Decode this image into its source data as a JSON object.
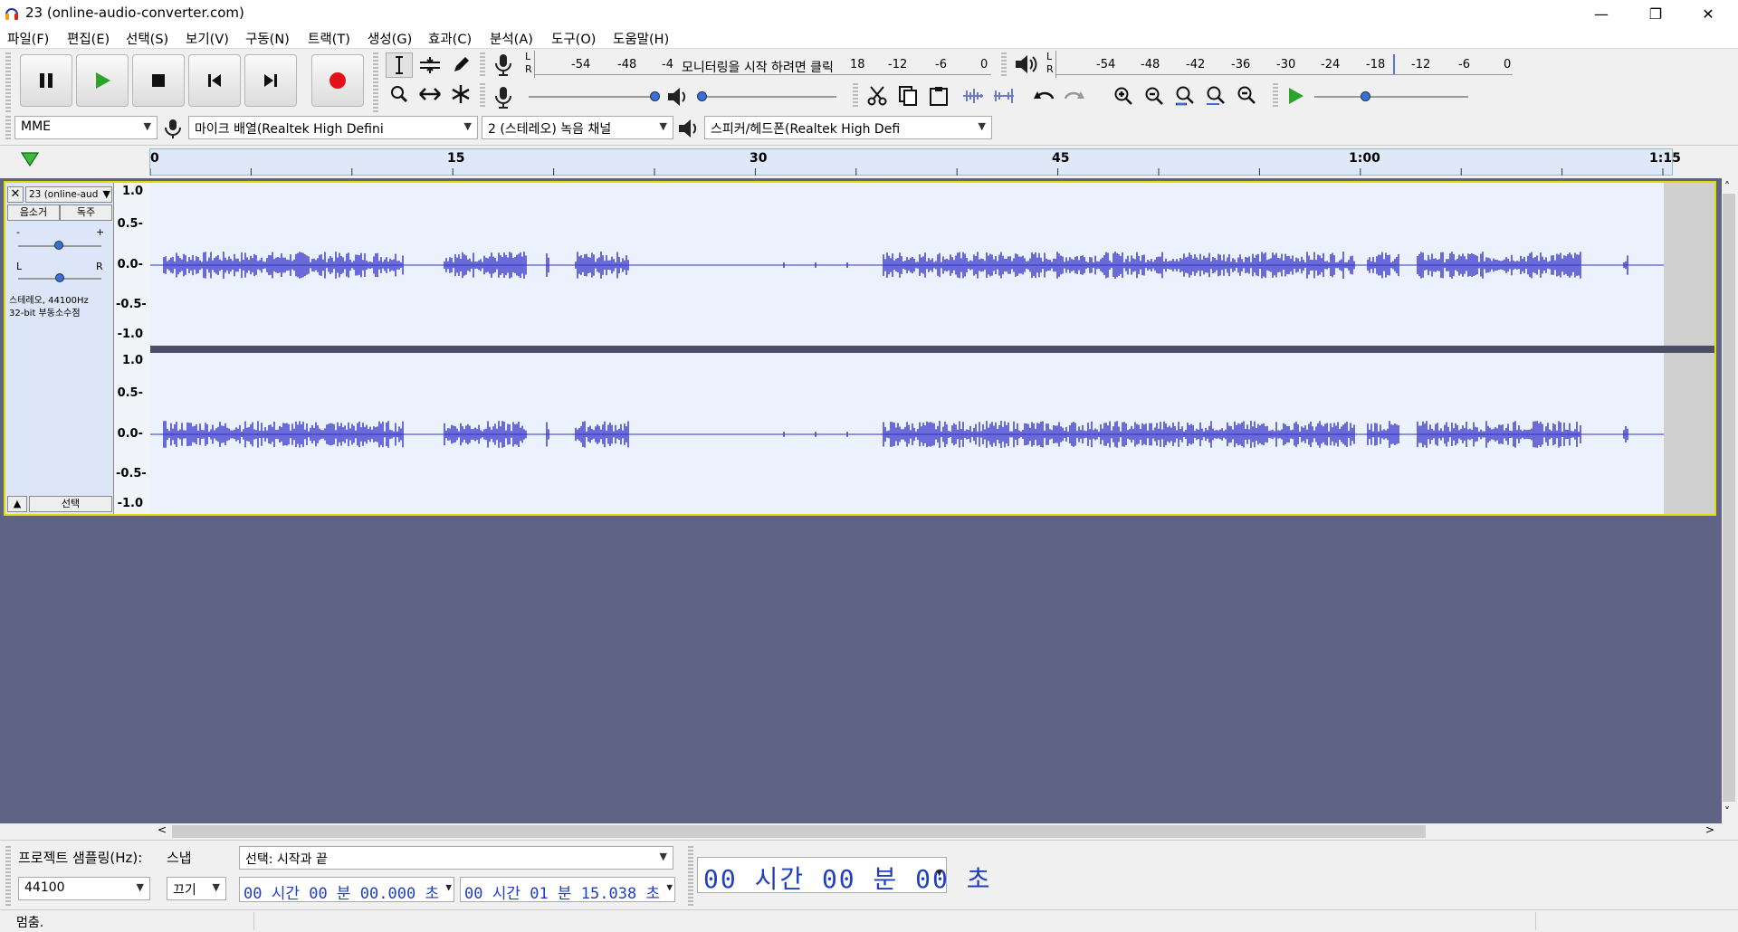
{
  "window": {
    "title": "23 (online-audio-converter.com)",
    "minimize_glyph": "—",
    "maximize_glyph": "❐",
    "close_glyph": "✕"
  },
  "menu": [
    "파일(F)",
    "편집(E)",
    "선택(S)",
    "보기(V)",
    "구동(N)",
    "트랙(T)",
    "생성(G)",
    "효과(C)",
    "분석(A)",
    "도구(O)",
    "도움말(H)"
  ],
  "meters": {
    "record_ticks": [
      "-54",
      "-48",
      "-4",
      "18",
      "-12",
      "-6",
      "0"
    ],
    "record_prompt": "모니터링을 시작 하려면 클릭",
    "play_ticks": [
      "-54",
      "-48",
      "-42",
      "-36",
      "-30",
      "-24",
      "-18",
      "-12",
      "-6",
      "0"
    ],
    "lr_l": "L",
    "lr_r": "R"
  },
  "devices": {
    "host": "MME",
    "input": "마이크 배열(Realtek High Defini",
    "channels": "2 (스테레오) 녹음 채널",
    "output": "스피커/헤드폰(Realtek High Defi"
  },
  "ruler": {
    "labels": [
      "0",
      "15",
      "30",
      "45",
      "1:00",
      "1:15"
    ]
  },
  "track": {
    "name": "23 (online-aud",
    "mute_label": "음소거",
    "solo_label": "독주",
    "gain_minus": "-",
    "gain_plus": "+",
    "pan_l": "L",
    "pan_r": "R",
    "info_line1": "스테레오, 44100Hz",
    "info_line2": "32-bit 부동소수점",
    "select_label": "선택",
    "scale": [
      "1.0",
      "0.5-",
      "0.0-",
      "-0.5-",
      "-1.0"
    ]
  },
  "selection_bar": {
    "rate_label": "프로젝트 샘플링(Hz):",
    "snap_label": "스냅",
    "selection_mode": "선택: 시작과 끝",
    "rate_value": "44100",
    "snap_value": "끄기",
    "start_time": "00 시간 00 분 00.000 초",
    "end_time": "00 시간 01 분 15.038 초",
    "position": "00 시간 00 분 00 초"
  },
  "status": {
    "text": "멈춤."
  }
}
